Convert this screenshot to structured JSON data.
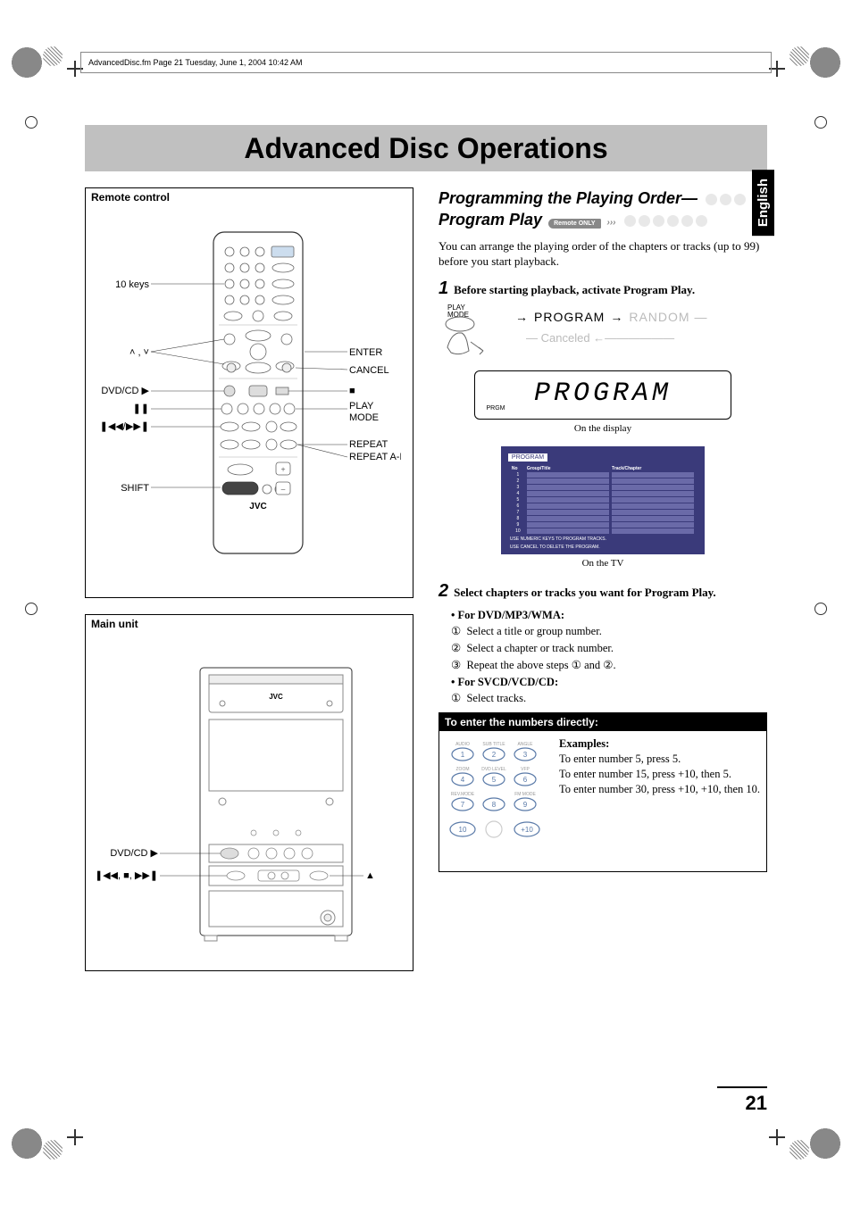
{
  "meta": {
    "header_line": "AdvancedDisc.fm  Page 21  Tuesday, June 1, 2004  10:42 AM"
  },
  "lang_tab": "English",
  "title": "Advanced Disc Operations",
  "remote_box": {
    "label": "Remote control",
    "callouts": {
      "ten_keys": "10 keys",
      "up_down": "˄ , ˅",
      "dvdcd": "DVD/CD ▶",
      "pause": "❚❚",
      "skip": "❚◀◀/▶▶❚",
      "shift": "SHIFT",
      "enter": "ENTER",
      "cancel": "CANCEL",
      "stop": "■",
      "play_mode_a": "PLAY",
      "play_mode_b": "MODE",
      "repeat": "REPEAT",
      "repeat_ab": "REPEAT A-B",
      "brand": "JVC"
    }
  },
  "main_unit_box": {
    "label": "Main unit",
    "callouts": {
      "dvdcd": "DVD/CD ▶",
      "transport": "❚◀◀, ■, ▶▶❚",
      "eject": "▲",
      "brand": "JVC"
    }
  },
  "section": {
    "heading_a": "Programming the Playing Order—",
    "heading_b": "Program Play",
    "remote_only": "Remote ONLY",
    "intro": "You can arrange the playing order of the chapters or tracks (up to 99) before you start playback."
  },
  "step1": {
    "num": "1",
    "text": "Before starting playback, activate Program Play.",
    "mode_label_a": "PLAY",
    "mode_label_b": "MODE",
    "flow_program": "PROGRAM",
    "flow_random": "RANDOM",
    "flow_canceled": "Canceled",
    "display_text": "PROGRAM",
    "display_tag": "PRGM",
    "display_caption": "On the display",
    "tv_title": "PROGRAM",
    "tv_headers": {
      "no": "No",
      "gt": "Group/Title",
      "tc": "Track/Chapter"
    },
    "tv_rows": [
      "1",
      "2",
      "3",
      "4",
      "5",
      "6",
      "7",
      "8",
      "9",
      "10"
    ],
    "tv_note1": "USE NUMERIC KEYS TO PROGRAM TRACKS.",
    "tv_note2": "USE CANCEL TO DELETE THE PROGRAM.",
    "tv_caption": "On the TV"
  },
  "step2": {
    "num": "2",
    "text": "Select chapters or tracks you want for Program Play.",
    "dvd_label": "• For DVD/MP3/WMA:",
    "dvd_1": "Select a title or group number.",
    "dvd_2": "Select a chapter or track number.",
    "dvd_3": "Repeat the above steps ① and ②.",
    "svcd_label": "• For SVCD/VCD/CD:",
    "svcd_1": "Select tracks."
  },
  "enter_box": {
    "header": "To enter the numbers directly:",
    "key_labels": {
      "audio": "AUDIO",
      "subtitle": "SUB TITLE",
      "angle": "ANGLE",
      "zoom": "ZOOM",
      "dvdlevel": "DVD LEVEL",
      "vfp": "VFP",
      "revmode": "REV.MODE",
      "blank": "",
      "fmmode": "FM MODE",
      "k1": "1",
      "k2": "2",
      "k3": "3",
      "k4": "4",
      "k5": "5",
      "k6": "6",
      "k7": "7",
      "k8": "8",
      "k9": "9",
      "k10": "10",
      "kplus10": "+10"
    },
    "examples_h": "Examples:",
    "ex1": "To enter number 5, press 5.",
    "ex2": "To enter number 15, press +10, then 5.",
    "ex3": "To enter number 30, press +10, +10, then 10."
  },
  "page_number": "21"
}
